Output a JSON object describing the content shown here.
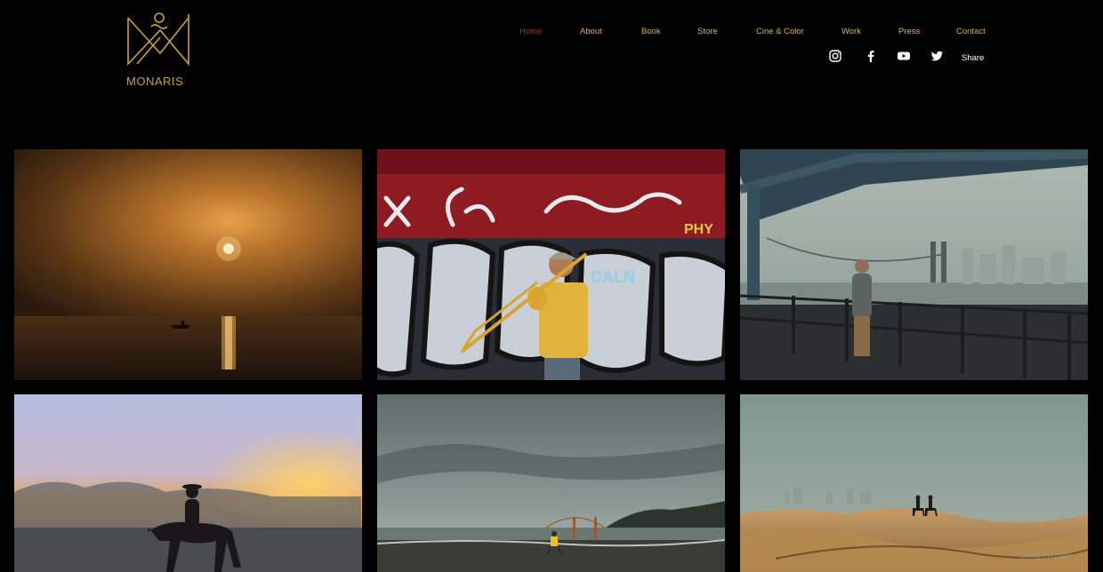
{
  "brand": {
    "logo_text": "MONARIS"
  },
  "nav": {
    "items": [
      {
        "label": "Home",
        "active": true
      },
      {
        "label": "About",
        "active": false
      },
      {
        "label": "Book",
        "active": false
      },
      {
        "label": "Store",
        "active": false
      },
      {
        "label": "Cine & Color",
        "active": false
      },
      {
        "label": "Work",
        "active": false
      },
      {
        "label": "Press",
        "active": false
      },
      {
        "label": "Contact",
        "active": false
      }
    ]
  },
  "social": {
    "icons": [
      "instagram-icon",
      "facebook-icon",
      "youtube-icon",
      "twitter-icon"
    ],
    "share_label": "Share"
  },
  "gallery": {
    "photos": [
      {
        "name": "sunset-ocean-boat"
      },
      {
        "name": "graffiti-trombone-player"
      },
      {
        "name": "bridge-pier-man"
      },
      {
        "name": "horse-rider-fog"
      },
      {
        "name": "beach-golden-gate-runner"
      },
      {
        "name": "desert-dunes-riders"
      }
    ],
    "watermark": "Using Formats"
  },
  "colors": {
    "background": "#000000",
    "nav_link": "#d8b24a",
    "nav_active": "#b8252a",
    "logo_gold": "#c9a237"
  }
}
